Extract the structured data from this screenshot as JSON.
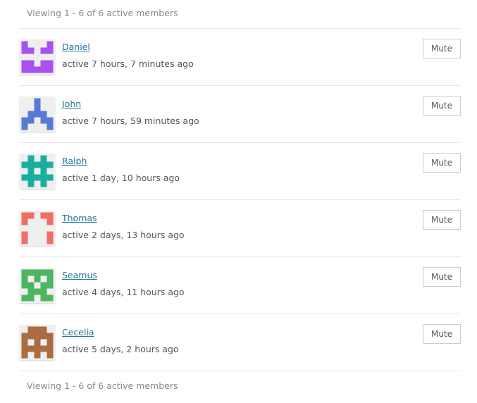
{
  "pagination": {
    "top_text": "Viewing 1 - 6 of 6 active members",
    "bottom_text": "Viewing 1 - 6 of 6 active members"
  },
  "members": [
    {
      "name": "Daniel",
      "activity": "active 7 hours, 7 minutes ago",
      "button": "Mute",
      "avatar": {
        "icon": "identicon-daniel",
        "color": "#a951ef",
        "pattern": [
          "1...1",
          "11.11",
          ".....",
          "11.11",
          "11111"
        ]
      }
    },
    {
      "name": "John",
      "activity": "active 7 hours, 59 minutes ago",
      "button": "Mute",
      "avatar": {
        "icon": "identicon-john",
        "color": "#587ad6",
        "pattern": [
          "..1..",
          "..1..",
          ".111.",
          "11.11",
          "1...1"
        ]
      }
    },
    {
      "name": "Ralph",
      "activity": "active 1 day, 10 hours ago",
      "button": "Mute",
      "avatar": {
        "icon": "identicon-ralph",
        "color": "#1aae9f",
        "pattern": [
          ".1.1.",
          "11111",
          ".1.1.",
          "11111",
          ".1.1."
        ]
      }
    },
    {
      "name": "Thomas",
      "activity": "active 2 days, 13 hours ago",
      "button": "Mute",
      "avatar": {
        "icon": "identicon-thomas",
        "color": "#ee6f64",
        "pattern": [
          "11.11",
          "1...1",
          ".....",
          "1...1",
          "1...1"
        ]
      }
    },
    {
      "name": "Seamus",
      "activity": "active 4 days, 11 hours ago",
      "button": "Mute",
      "avatar": {
        "icon": "identicon-seamus",
        "color": "#4cb562",
        "pattern": [
          "11111",
          "1.1.1",
          "11.11",
          ".111.",
          "11.11"
        ]
      }
    },
    {
      "name": "Cecelia",
      "activity": "active 5 days, 2 hours ago",
      "button": "Mute",
      "avatar": {
        "icon": "identicon-cecelia",
        "color": "#a96c43",
        "pattern": [
          ".111.",
          "11111",
          "1.1.1",
          "11111",
          "1.1.1"
        ]
      }
    }
  ]
}
